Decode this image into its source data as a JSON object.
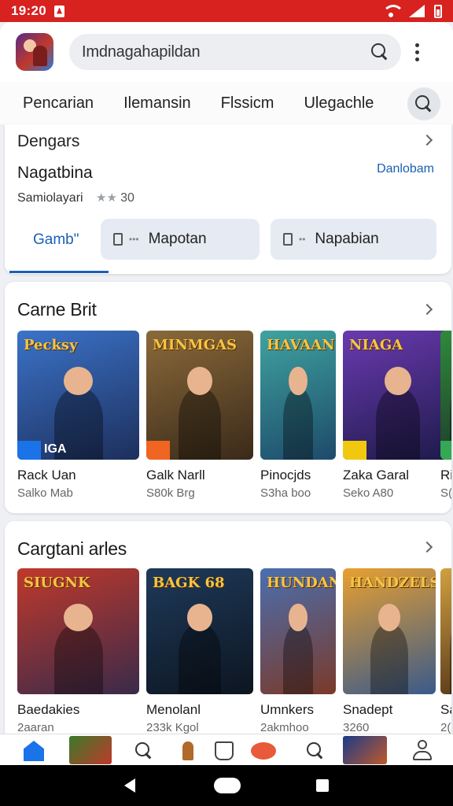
{
  "status_bar": {
    "time": "19:20"
  },
  "search": {
    "text": "Imdnagahapildan"
  },
  "tabs": [
    "Pencarian",
    "Ilemansin",
    "Flssicm",
    "Ulegachle"
  ],
  "card": {
    "title": "Dengars",
    "subtitle": "Nagatbina",
    "link": "Danlobam",
    "meta_label": "Samiolayari",
    "meta_value": "30",
    "active_tab": "Gamb\"",
    "chips": [
      "Mapotan",
      "Napabian"
    ]
  },
  "section1": {
    "title": "Carne  Brit",
    "items": [
      {
        "name": "Rack Uan",
        "sub": "Salko Mab",
        "logo": "Pecksy",
        "badge_text": "IGA",
        "colors": [
          "#3b73c9",
          "#1d2f5c"
        ],
        "badge_color": "#1a73e8"
      },
      {
        "name": "Galk Narll",
        "sub": "S80k Brg",
        "logo": "MINMGAS",
        "badge_text": "",
        "colors": [
          "#8a6a3a",
          "#3a2a1a"
        ],
        "badge_color": "#f06522"
      },
      {
        "name": "Pinocjds",
        "sub": "S3ha boo",
        "logo": "HAVAAN",
        "badge_text": "",
        "colors": [
          "#3fa3a0",
          "#1d4a6a"
        ],
        "badge_color": ""
      },
      {
        "name": "Zaka Garal",
        "sub": "Seko A80",
        "logo": "NIAGA",
        "badge_text": "",
        "colors": [
          "#6a3ab0",
          "#1d1a4a"
        ],
        "badge_color": "#f2c80f"
      },
      {
        "name": "Ri",
        "sub": "S(",
        "logo": "",
        "badge_text": "",
        "colors": [
          "#2f8a3a",
          "#1d3a2a"
        ],
        "badge_color": "#34a853"
      }
    ]
  },
  "section2": {
    "title": "Cargtani arles",
    "items": [
      {
        "name": "Baedakies",
        "sub": "2aaran",
        "logo": "SIUGNK",
        "colors": [
          "#c0392b",
          "#3a2a4a"
        ]
      },
      {
        "name": "Menolanl",
        "sub": "233k Kgol",
        "logo": "BAGK 68",
        "colors": [
          "#1e3a5a",
          "#0d1520"
        ]
      },
      {
        "name": "Umnkers",
        "sub": "2akmhoo",
        "logo": "HUNDAN",
        "colors": [
          "#4a6fb0",
          "#7a3a2a"
        ]
      },
      {
        "name": "Snadept",
        "sub": "3260",
        "logo": "HANDZELS",
        "colors": [
          "#e8a030",
          "#3a5a8a"
        ]
      },
      {
        "name": "Sa",
        "sub": "2(",
        "logo": "",
        "colors": [
          "#d0a040",
          "#5a3a1a"
        ]
      }
    ]
  },
  "bottom_nav": [
    "home-icon",
    "game-thumb-icon",
    "search-icon",
    "character-icon",
    "store-bag-icon",
    "bird-icon",
    "search-icon",
    "game-cover-icon",
    "account-icon"
  ],
  "colors": {
    "status_bar": "#d7221f",
    "accent": "#1a5fb4",
    "nav_home": "#1a73e8"
  }
}
